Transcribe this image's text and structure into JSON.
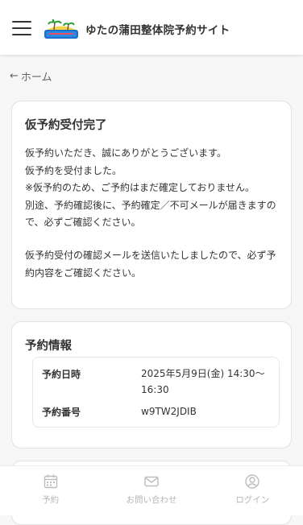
{
  "header": {
    "menu_icon": "hamburger-menu-icon",
    "logo_icon": "palm-tree-logo",
    "title": "ゆたの蒲田整体院予約サイト"
  },
  "breadcrumb": {
    "arrow": "←",
    "home_label": "ホーム"
  },
  "completion_card": {
    "title": "仮予約受付完了",
    "lines_a": [
      "仮予約いただき、誠にありがとうございます。",
      "仮予約を受付ました。",
      "※仮予約のため、ご予約はまだ確定しておりません。",
      "別途、予約確認後に、予約確定／不可メールが届きますので、必ずご確認ください。"
    ],
    "lines_b": [
      "仮予約受付の確認メールを送信いたしましたので、必ず予約内容をご確認ください。"
    ]
  },
  "reservation_card": {
    "title": "予約情報",
    "datetime_label": "予約日時",
    "datetime_value": "2025年5月9日(金) 14:30〜16:30",
    "number_label": "予約番号",
    "number_value": "w9TW2JDIB"
  },
  "bottom_nav": {
    "items": [
      {
        "label": "予約",
        "icon": "calendar-icon"
      },
      {
        "label": "お問い合わせ",
        "icon": "mail-icon"
      },
      {
        "label": "ログイン",
        "icon": "user-icon"
      }
    ],
    "inactive_color": "#b5b5b5"
  }
}
